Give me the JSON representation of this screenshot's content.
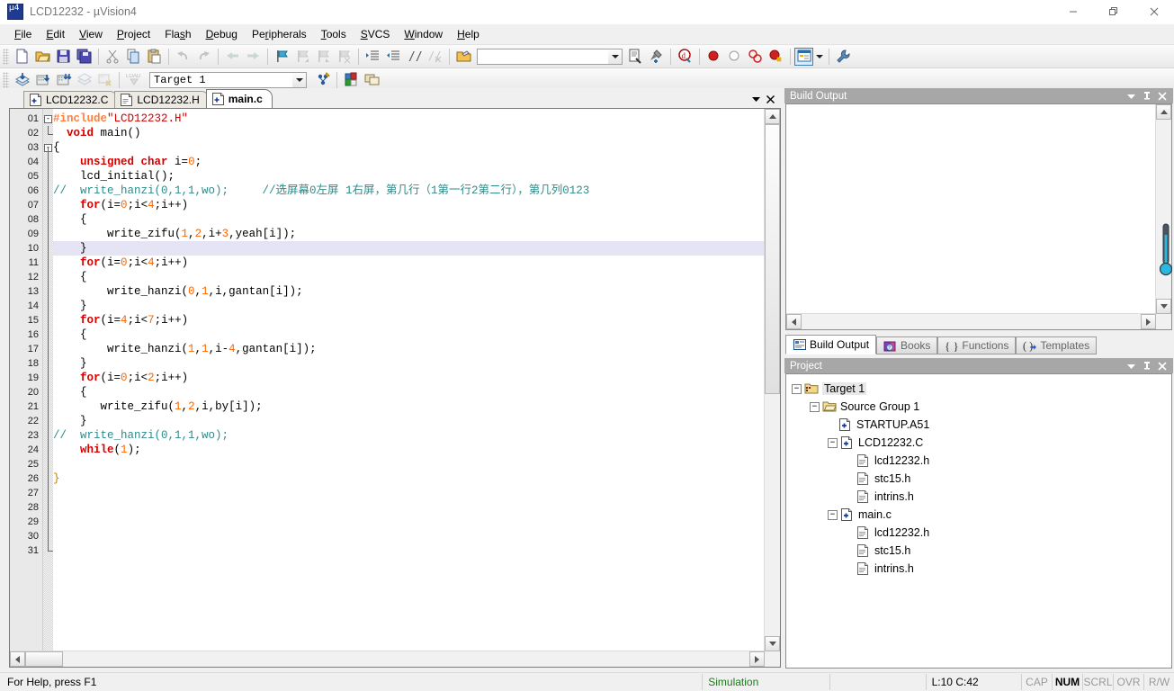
{
  "window": {
    "title": "LCD12232  - µVision4",
    "icon": "uvision-logo-icon",
    "minimize": "—",
    "maximize": "❐",
    "close": "✕"
  },
  "menubar": {
    "items": [
      {
        "label": "File",
        "accel": "F"
      },
      {
        "label": "Edit",
        "accel": "E"
      },
      {
        "label": "View",
        "accel": "V"
      },
      {
        "label": "Project",
        "accel": "P"
      },
      {
        "label": "Flash",
        "accel": "s"
      },
      {
        "label": "Debug",
        "accel": "D"
      },
      {
        "label": "Peripherals",
        "accel": "r"
      },
      {
        "label": "Tools",
        "accel": "T"
      },
      {
        "label": "SVCS",
        "accel": "S"
      },
      {
        "label": "Window",
        "accel": "W"
      },
      {
        "label": "Help",
        "accel": "H"
      }
    ]
  },
  "toolbar_main": {
    "buttons": [
      "new-file-icon",
      "open-file-icon",
      "save-icon",
      "save-all-icon",
      "cut-icon",
      "copy-icon",
      "paste-icon",
      "undo-icon",
      "redo-icon",
      "navigate-back-icon",
      "navigate-forward-icon",
      "bookmark-toggle-icon",
      "bookmark-prev-icon",
      "bookmark-next-icon",
      "bookmark-clear-icon",
      "indent-icon",
      "outdent-icon",
      "comment-icon",
      "uncomment-icon",
      "open-in-editor-icon",
      "find-in-files-icon",
      "configure-tools-icon",
      "debug-session-icon",
      "breakpoint-insert-icon",
      "breakpoint-disable-icon",
      "breakpoint-killall-icon",
      "breakpoint-disableall-icon",
      "project-window-icon",
      "settings-wrench-icon"
    ],
    "search_box_value": "",
    "search_box_placeholder": ""
  },
  "toolbar_build": {
    "buttons": [
      "translate-icon",
      "build-target-icon",
      "rebuild-all-icon",
      "batch-build-icon",
      "stop-build-icon",
      "download-icon"
    ],
    "target_select": {
      "value": "Target 1",
      "options": [
        "Target 1"
      ]
    },
    "after_buttons": [
      "target-options-icon",
      "manage-components-icon",
      "multi-project-icon"
    ]
  },
  "editor": {
    "tabs": [
      {
        "label": "LCD12232.C",
        "icon": "c-file-icon",
        "selected": false
      },
      {
        "label": "LCD12232.H",
        "icon": "h-file-icon",
        "selected": false
      },
      {
        "label": "main.c",
        "icon": "c-file-icon",
        "selected": true
      }
    ],
    "tab_menu_icon": "chevron-down-icon",
    "tab_close_icon": "close-icon",
    "current_line": 10,
    "lines": [
      {
        "n": "01",
        "fold": "minus",
        "tokens": [
          {
            "t": "#include",
            "c": "pp"
          },
          {
            "t": "\"LCD12232.H\"",
            "c": "str"
          }
        ]
      },
      {
        "n": "02",
        "fold": "end",
        "tokens": [
          {
            "t": "  ",
            "c": "pl"
          },
          {
            "t": "void",
            "c": "kw"
          },
          {
            "t": " main()",
            "c": "pl"
          }
        ]
      },
      {
        "n": "03",
        "fold": "minus",
        "tokens": [
          {
            "t": "{",
            "c": "pl"
          }
        ]
      },
      {
        "n": "04",
        "fold": "",
        "tokens": [
          {
            "t": "    ",
            "c": "pl"
          },
          {
            "t": "unsigned char",
            "c": "kw"
          },
          {
            "t": " i=",
            "c": "pl"
          },
          {
            "t": "0",
            "c": "num"
          },
          {
            "t": ";",
            "c": "pl"
          }
        ]
      },
      {
        "n": "05",
        "fold": "",
        "tokens": [
          {
            "t": "    lcd_initial();",
            "c": "pl"
          }
        ]
      },
      {
        "n": "06",
        "fold": "",
        "tokens": [
          {
            "t": "//  write_hanzi(0,1,1,wo);     //选屏幕0左屏 1右屏，第几行（1第一行2第二行），第几列0123",
            "c": "cm"
          }
        ]
      },
      {
        "n": "07",
        "fold": "",
        "tokens": [
          {
            "t": "    ",
            "c": "pl"
          },
          {
            "t": "for",
            "c": "kw"
          },
          {
            "t": "(i=",
            "c": "pl"
          },
          {
            "t": "0",
            "c": "num"
          },
          {
            "t": ";i<",
            "c": "pl"
          },
          {
            "t": "4",
            "c": "num"
          },
          {
            "t": ";i++)",
            "c": "pl"
          }
        ]
      },
      {
        "n": "08",
        "fold": "",
        "tokens": [
          {
            "t": "    {",
            "c": "pl"
          }
        ]
      },
      {
        "n": "09",
        "fold": "",
        "tokens": [
          {
            "t": "        write_zifu(",
            "c": "pl"
          },
          {
            "t": "1",
            "c": "num"
          },
          {
            "t": ",",
            "c": "pl"
          },
          {
            "t": "2",
            "c": "num"
          },
          {
            "t": ",i+",
            "c": "pl"
          },
          {
            "t": "3",
            "c": "num"
          },
          {
            "t": ",yeah[i]);",
            "c": "pl"
          }
        ]
      },
      {
        "n": "10",
        "fold": "",
        "hl": true,
        "tokens": [
          {
            "t": "    }",
            "c": "pl"
          }
        ]
      },
      {
        "n": "11",
        "fold": "",
        "tokens": [
          {
            "t": "    ",
            "c": "pl"
          },
          {
            "t": "for",
            "c": "kw"
          },
          {
            "t": "(i=",
            "c": "pl"
          },
          {
            "t": "0",
            "c": "num"
          },
          {
            "t": ";i<",
            "c": "pl"
          },
          {
            "t": "4",
            "c": "num"
          },
          {
            "t": ";i++)",
            "c": "pl"
          }
        ]
      },
      {
        "n": "12",
        "fold": "",
        "tokens": [
          {
            "t": "    {",
            "c": "pl"
          }
        ]
      },
      {
        "n": "13",
        "fold": "",
        "tokens": [
          {
            "t": "        write_hanzi(",
            "c": "pl"
          },
          {
            "t": "0",
            "c": "num"
          },
          {
            "t": ",",
            "c": "pl"
          },
          {
            "t": "1",
            "c": "num"
          },
          {
            "t": ",i,gantan[i]);",
            "c": "pl"
          }
        ]
      },
      {
        "n": "14",
        "fold": "",
        "tokens": [
          {
            "t": "    }",
            "c": "pl"
          }
        ]
      },
      {
        "n": "15",
        "fold": "",
        "tokens": [
          {
            "t": "    ",
            "c": "pl"
          },
          {
            "t": "for",
            "c": "kw"
          },
          {
            "t": "(i=",
            "c": "pl"
          },
          {
            "t": "4",
            "c": "num"
          },
          {
            "t": ";i<",
            "c": "pl"
          },
          {
            "t": "7",
            "c": "num"
          },
          {
            "t": ";i++)",
            "c": "pl"
          }
        ]
      },
      {
        "n": "16",
        "fold": "",
        "tokens": [
          {
            "t": "    {",
            "c": "pl"
          }
        ]
      },
      {
        "n": "17",
        "fold": "",
        "tokens": [
          {
            "t": "        write_hanzi(",
            "c": "pl"
          },
          {
            "t": "1",
            "c": "num"
          },
          {
            "t": ",",
            "c": "pl"
          },
          {
            "t": "1",
            "c": "num"
          },
          {
            "t": ",i-",
            "c": "pl"
          },
          {
            "t": "4",
            "c": "num"
          },
          {
            "t": ",gantan[i]);",
            "c": "pl"
          }
        ]
      },
      {
        "n": "18",
        "fold": "",
        "tokens": [
          {
            "t": "    }",
            "c": "pl"
          }
        ]
      },
      {
        "n": "19",
        "fold": "",
        "tokens": [
          {
            "t": "    ",
            "c": "pl"
          },
          {
            "t": "for",
            "c": "kw"
          },
          {
            "t": "(i=",
            "c": "pl"
          },
          {
            "t": "0",
            "c": "num"
          },
          {
            "t": ";i<",
            "c": "pl"
          },
          {
            "t": "2",
            "c": "num"
          },
          {
            "t": ";i++)",
            "c": "pl"
          }
        ]
      },
      {
        "n": "20",
        "fold": "",
        "tokens": [
          {
            "t": "    {",
            "c": "pl"
          }
        ]
      },
      {
        "n": "21",
        "fold": "",
        "tokens": [
          {
            "t": "       write_zifu(",
            "c": "pl"
          },
          {
            "t": "1",
            "c": "num"
          },
          {
            "t": ",",
            "c": "pl"
          },
          {
            "t": "2",
            "c": "num"
          },
          {
            "t": ",i,by[i]);",
            "c": "pl"
          }
        ]
      },
      {
        "n": "22",
        "fold": "",
        "tokens": [
          {
            "t": "    }",
            "c": "pl"
          }
        ]
      },
      {
        "n": "23",
        "fold": "",
        "tokens": [
          {
            "t": "//  write_hanzi(0,1,1,wo);",
            "c": "cm"
          }
        ]
      },
      {
        "n": "24",
        "fold": "",
        "tokens": [
          {
            "t": "    ",
            "c": "pl"
          },
          {
            "t": "while",
            "c": "kw"
          },
          {
            "t": "(",
            "c": "pl"
          },
          {
            "t": "1",
            "c": "num"
          },
          {
            "t": ");",
            "c": "pl"
          }
        ]
      },
      {
        "n": "25",
        "fold": "",
        "tokens": []
      },
      {
        "n": "26",
        "fold": "endlast",
        "tokens": [
          {
            "t": "}",
            "c": "brace"
          }
        ]
      },
      {
        "n": "27",
        "fold": "",
        "tokens": []
      },
      {
        "n": "28",
        "fold": "",
        "tokens": []
      },
      {
        "n": "29",
        "fold": "",
        "tokens": []
      },
      {
        "n": "30",
        "fold": "",
        "tokens": []
      },
      {
        "n": "31",
        "fold": "",
        "tokens": []
      }
    ]
  },
  "build_output": {
    "title": "Build Output",
    "content": "",
    "panel_buttons": [
      "chevron-down-icon",
      "pin-icon",
      "close-icon"
    ],
    "tabs": [
      {
        "label": "Build Output",
        "icon": "build-output-icon",
        "selected": true
      },
      {
        "label": "Books",
        "icon": "books-icon",
        "selected": false
      },
      {
        "label": "Functions",
        "icon": "functions-icon",
        "selected": false
      },
      {
        "label": "Templates",
        "icon": "templates-icon",
        "selected": false
      }
    ]
  },
  "project": {
    "title": "Project",
    "panel_buttons": [
      "chevron-down-icon",
      "pin-icon",
      "close-icon"
    ],
    "tree": [
      {
        "label": "Target 1",
        "depth": 0,
        "expander": "minus",
        "icon": "target-icon",
        "selected": true
      },
      {
        "label": "Source Group 1",
        "depth": 1,
        "expander": "minus",
        "icon": "folder-icon",
        "selected": false
      },
      {
        "label": "STARTUP.A51",
        "depth": 2,
        "expander": "none",
        "icon": "source-file-icon",
        "selected": false
      },
      {
        "label": "LCD12232.C",
        "depth": 2,
        "expander": "minus",
        "icon": "source-file-icon",
        "selected": false
      },
      {
        "label": "lcd12232.h",
        "depth": 3,
        "expander": "none",
        "icon": "header-file-icon",
        "selected": false
      },
      {
        "label": "stc15.h",
        "depth": 3,
        "expander": "none",
        "icon": "header-file-icon",
        "selected": false
      },
      {
        "label": "intrins.h",
        "depth": 3,
        "expander": "none",
        "icon": "header-file-icon",
        "selected": false
      },
      {
        "label": "main.c",
        "depth": 2,
        "expander": "minus",
        "icon": "source-file-icon",
        "selected": false
      },
      {
        "label": "lcd12232.h",
        "depth": 3,
        "expander": "none",
        "icon": "header-file-icon",
        "selected": false
      },
      {
        "label": "stc15.h",
        "depth": 3,
        "expander": "none",
        "icon": "header-file-icon",
        "selected": false
      },
      {
        "label": "intrins.h",
        "depth": 3,
        "expander": "none",
        "icon": "header-file-icon",
        "selected": false
      }
    ]
  },
  "statusbar": {
    "help": "For Help, press F1",
    "simulation": "Simulation",
    "blank": "",
    "cursor_pos": "L:10 C:42",
    "indicators": [
      {
        "label": "CAP",
        "on": false
      },
      {
        "label": "NUM",
        "on": true
      },
      {
        "label": "SCRL",
        "on": false
      },
      {
        "label": "OVR",
        "on": false
      },
      {
        "label": "R/W",
        "on": false
      }
    ]
  },
  "colors": {
    "keyword": "#d40000",
    "number": "#ff6600",
    "comment": "#2e8b8b",
    "preprocessor": "#ff8040",
    "highlight_line": "#e4e4f5",
    "panel_title": "#a7a7a7",
    "status_simulation": "#1a7a1a"
  }
}
